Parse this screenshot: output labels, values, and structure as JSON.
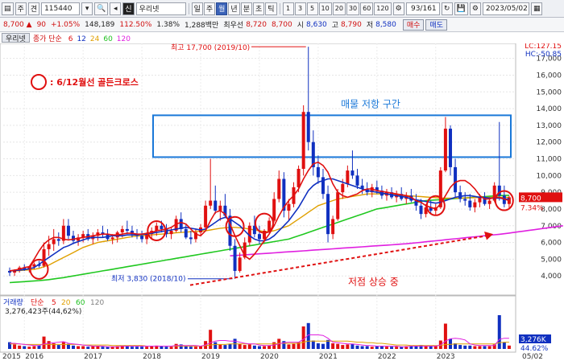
{
  "toolbar": {
    "market": "주",
    "code_type": "견",
    "code": "115440",
    "name_flag": "신",
    "name": "우리넷",
    "periods": [
      "일",
      "주",
      "월",
      "년",
      "분",
      "초",
      "틱"
    ],
    "active_period": "월",
    "intervals": [
      "1",
      "3",
      "5",
      "10",
      "20",
      "30",
      "60",
      "120"
    ],
    "page": "93/161",
    "date": "2023/05/02"
  },
  "quote": {
    "price": "8,700",
    "change": "90",
    "change_pct": "+1.05%",
    "volume": "148,189",
    "vol_ratio": "112.50%",
    "turnover_rate": "1.38%",
    "amount": "1,288백만",
    "best_label": "최우선",
    "best_value": "8,720",
    "current": "8,700",
    "open_label": "시",
    "open": "8,630",
    "high_label": "고",
    "high": "8,790",
    "low_label": "저",
    "low": "8,580",
    "buy_label": "매수",
    "sell_label": "매도"
  },
  "main_tab": "우리넷",
  "main_legend": {
    "title": "종가 단순",
    "ma": [
      {
        "label": "6",
        "color": "#e01010"
      },
      {
        "label": "12",
        "color": "#1030c0"
      },
      {
        "label": "24",
        "color": "#e0a000"
      },
      {
        "label": "60",
        "color": "#20c020"
      },
      {
        "label": "120",
        "color": "#e020e0"
      }
    ]
  },
  "volume_tab": "거래량",
  "volume_legend": {
    "title": "단순",
    "ma": [
      {
        "label": "5",
        "color": "#e01010"
      },
      {
        "label": "20",
        "color": "#e0a000"
      },
      {
        "label": "60",
        "color": "#20c020"
      },
      {
        "label": "120",
        "color": "#808080"
      }
    ]
  },
  "volume_value": "3,276,423주(44,62%)",
  "annotations": {
    "golden_cross": ": 6/12월선 골든크로스",
    "resistance": "매물 저항 구간",
    "rising_low": "저점 상승 중",
    "high_label": "최고 17,700 (2019/10)",
    "low_label": "최저 3,830 (2018/10)"
  },
  "axis_info": {
    "lc": "LC:127.15",
    "hc": "HC:-50.85",
    "current_price": "8,700",
    "pct": "7.34%",
    "vol_current": "3,276K",
    "vol_pct": "44.62%",
    "last_date": "05/02"
  },
  "chart_data": {
    "type": "candlestick",
    "ylim": [
      3000,
      17800
    ],
    "y_ticks": [
      "17,000",
      "16,000",
      "15,000",
      "14,000",
      "13,000",
      "12,000",
      "11,000",
      "10,000",
      "9,000",
      "8,000",
      "7,000",
      "6,000",
      "5,000",
      "4,000"
    ],
    "x_ticks": [
      "2015",
      "2016",
      "2017",
      "2018",
      "2019",
      "2020",
      "2021",
      "2022",
      "2023"
    ],
    "colors": {
      "up": "#e01010",
      "down": "#1030c0"
    },
    "start": "2015-10",
    "candles": [
      [
        4300,
        4500,
        4000,
        4200
      ],
      [
        4200,
        4400,
        4000,
        4350
      ],
      [
        4350,
        4600,
        4200,
        4500
      ],
      [
        4500,
        4700,
        4300,
        4400
      ],
      [
        4400,
        4600,
        4200,
        4550
      ],
      [
        4550,
        4800,
        4400,
        4700
      ],
      [
        4700,
        4900,
        4500,
        4600
      ],
      [
        4600,
        6000,
        4500,
        5600
      ],
      [
        5600,
        6400,
        5200,
        5900
      ],
      [
        5900,
        6800,
        5500,
        6200
      ],
      [
        6200,
        6600,
        5800,
        6100
      ],
      [
        6100,
        7400,
        5900,
        7000
      ],
      [
        7000,
        7400,
        6200,
        6400
      ],
      [
        6400,
        6700,
        5900,
        6100
      ],
      [
        6100,
        6500,
        5800,
        6300
      ],
      [
        6300,
        6700,
        6000,
        6500
      ],
      [
        6500,
        6800,
        6100,
        6200
      ],
      [
        6200,
        6600,
        5900,
        6400
      ],
      [
        6400,
        6800,
        6100,
        6600
      ],
      [
        6600,
        7000,
        6300,
        6500
      ],
      [
        6500,
        6800,
        6100,
        6200
      ],
      [
        6200,
        6500,
        5900,
        6300
      ],
      [
        6300,
        6700,
        6000,
        6600
      ],
      [
        6600,
        7000,
        6300,
        6800
      ],
      [
        6800,
        7300,
        6500,
        6700
      ],
      [
        6700,
        7000,
        6300,
        6500
      ],
      [
        6500,
        6800,
        6200,
        6400
      ],
      [
        6400,
        6700,
        6000,
        6200
      ],
      [
        6200,
        6600,
        5900,
        6500
      ],
      [
        6500,
        6900,
        6200,
        6700
      ],
      [
        6700,
        7200,
        6400,
        7000
      ],
      [
        7000,
        7300,
        6600,
        6800
      ],
      [
        6800,
        7100,
        6300,
        6500
      ],
      [
        6500,
        6900,
        6200,
        6700
      ],
      [
        6700,
        7600,
        6600,
        7400
      ],
      [
        7400,
        7800,
        6600,
        6800
      ],
      [
        6800,
        7100,
        6200,
        6300
      ],
      [
        6300,
        6700,
        5900,
        6200
      ],
      [
        6200,
        6800,
        6000,
        6600
      ],
      [
        6600,
        7100,
        6400,
        6900
      ],
      [
        6900,
        8500,
        6800,
        8200
      ],
      [
        8200,
        11000,
        8000,
        8500
      ],
      [
        8500,
        9400,
        7700,
        7900
      ],
      [
        7900,
        8500,
        7300,
        8200
      ],
      [
        8200,
        8900,
        7500,
        7600
      ],
      [
        7600,
        8000,
        5500,
        5800
      ],
      [
        5800,
        6200,
        3830,
        4300
      ],
      [
        4300,
        5400,
        4200,
        5100
      ],
      [
        5100,
        6300,
        5000,
        6000
      ],
      [
        6000,
        7200,
        5800,
        7000
      ],
      [
        7000,
        7600,
        6300,
        6500
      ],
      [
        6500,
        7000,
        5900,
        6200
      ],
      [
        6200,
        6800,
        6000,
        6700
      ],
      [
        6700,
        7500,
        6500,
        7300
      ],
      [
        7300,
        9000,
        7200,
        8600
      ],
      [
        8600,
        10300,
        8400,
        9800
      ],
      [
        9800,
        10200,
        7500,
        7900
      ],
      [
        7900,
        8600,
        7300,
        8300
      ],
      [
        8300,
        9600,
        8100,
        9300
      ],
      [
        9300,
        10600,
        9000,
        10400
      ],
      [
        10400,
        14200,
        10000,
        13800
      ],
      [
        13800,
        17700,
        11500,
        12000
      ],
      [
        12000,
        12700,
        10000,
        10500
      ],
      [
        10500,
        11200,
        9500,
        9900
      ],
      [
        9900,
        10400,
        8600,
        8900
      ],
      [
        8900,
        9400,
        6000,
        6500
      ],
      [
        6500,
        7600,
        6200,
        7400
      ],
      [
        7400,
        9200,
        7300,
        9000
      ],
      [
        9000,
        9800,
        8600,
        9500
      ],
      [
        9500,
        10600,
        9300,
        10300
      ],
      [
        10300,
        11500,
        9800,
        10000
      ],
      [
        10000,
        10400,
        9200,
        9400
      ],
      [
        9400,
        9800,
        8900,
        9200
      ],
      [
        9200,
        9600,
        8800,
        9000
      ],
      [
        9000,
        9500,
        8700,
        9300
      ],
      [
        9300,
        9700,
        8900,
        9100
      ],
      [
        9100,
        9400,
        8600,
        8800
      ],
      [
        8800,
        9200,
        8500,
        9000
      ],
      [
        9000,
        9300,
        8600,
        8700
      ],
      [
        8700,
        9100,
        8400,
        8900
      ],
      [
        8900,
        9300,
        8500,
        8600
      ],
      [
        8600,
        9000,
        8300,
        8800
      ],
      [
        8800,
        9200,
        8400,
        8500
      ],
      [
        8500,
        8900,
        7900,
        8200
      ],
      [
        8200,
        8600,
        7400,
        7700
      ],
      [
        7700,
        8300,
        7500,
        8100
      ],
      [
        8100,
        8500,
        7700,
        7900
      ],
      [
        7900,
        8300,
        7600,
        8100
      ],
      [
        8100,
        10500,
        8000,
        10300
      ],
      [
        10300,
        13500,
        10200,
        12800
      ],
      [
        12800,
        13000,
        10000,
        10500
      ],
      [
        10500,
        11000,
        8700,
        9000
      ],
      [
        9000,
        9400,
        8400,
        8600
      ],
      [
        8600,
        9000,
        8200,
        8500
      ],
      [
        8500,
        8900,
        7900,
        8100
      ],
      [
        8100,
        8600,
        7800,
        8400
      ],
      [
        8400,
        8900,
        8100,
        8700
      ],
      [
        8700,
        9000,
        8200,
        8300
      ],
      [
        8300,
        8700,
        8000,
        8500
      ],
      [
        8500,
        9600,
        8400,
        9400
      ],
      [
        9400,
        13200,
        8500,
        8800
      ],
      [
        8800,
        9400,
        8100,
        8300
      ],
      [
        8300,
        8800,
        8000,
        8700
      ]
    ],
    "ma6": [
      4300,
      4350,
      4400,
      4500,
      4550,
      5000,
      5500,
      5900,
      6150,
      6300,
      6300,
      6200,
      6150,
      6200,
      6250,
      6300,
      6350,
      6400,
      6450,
      6500,
      6500,
      6450,
      6450,
      6500,
      6550,
      6550,
      6500,
      6500,
      6550,
      6600,
      6700,
      6750,
      6800,
      6900,
      7100,
      7200,
      7100,
      6800,
      6500,
      6400,
      6700,
      7300,
      7800,
      7900,
      7700,
      7100,
      6400,
      5800,
      5200,
      5000,
      5300,
      5700,
      6100,
      6500,
      7000,
      7600,
      8100,
      8500,
      8800,
      9200,
      9800,
      10300,
      10700,
      10800,
      10600,
      10200,
      9500,
      9000,
      8800,
      8700,
      8800,
      8900,
      9100,
      9200,
      9200,
      9100,
      9050,
      9000,
      8950,
      8900,
      8850,
      8800,
      8700,
      8500,
      8400,
      8200,
      8100,
      8000,
      8300,
      8800,
      9300,
      9600,
      9700,
      9700,
      9500,
      9200,
      8800,
      8600,
      8600,
      8700,
      8700,
      8600,
      8500
    ],
    "ma12": [
      4300,
      4320,
      4350,
      4380,
      4420,
      4500,
      4700,
      4900,
      5100,
      5300,
      5500,
      5700,
      5800,
      5950,
      6050,
      6150,
      6250,
      6300,
      6300,
      6300,
      6350,
      6400,
      6400,
      6400,
      6450,
      6450,
      6450,
      6480,
      6500,
      6550,
      6600,
      6650,
      6700,
      6750,
      6800,
      6850,
      6900,
      6850,
      6800,
      6750,
      6800,
      7000,
      7200,
      7400,
      7500,
      7400,
      7200,
      7000,
      6700,
      6400,
      6200,
      6100,
      6100,
      6200,
      6400,
      6700,
      7000,
      7300,
      7700,
      8100,
      8600,
      9100,
      9400,
      9600,
      9700,
      9800,
      9800,
      9700,
      9600,
      9500,
      9400,
      9300,
      9200,
      9100,
      9050,
      9000,
      8950,
      8900,
      8850,
      8800,
      8750,
      8700,
      8600,
      8550,
      8500,
      8450,
      8400,
      8350,
      8400,
      8500,
      8600,
      8700,
      8750,
      8800,
      8800,
      8750,
      8700,
      8700,
      8650,
      8650,
      8650,
      8600,
      8600
    ],
    "ma24": [
      4300,
      4300,
      4320,
      4340,
      4360,
      4400,
      4450,
      4550,
      4650,
      4800,
      4950,
      5100,
      5250,
      5400,
      5550,
      5700,
      5800,
      5900,
      6000,
      6050,
      6100,
      6150,
      6200,
      6250,
      6300,
      6350,
      6380,
      6400,
      6420,
      6450,
      6480,
      6500,
      6520,
      6550,
      6580,
      6600,
      6620,
      6640,
      6660,
      6680,
      6700,
      6750,
      6800,
      6850,
      6880,
      6900,
      6900,
      6880,
      6850,
      6800,
      6750,
      6700,
      6650,
      6650,
      6700,
      6800,
      6900,
      7000,
      7200,
      7400,
      7600,
      7800,
      8000,
      8200,
      8300,
      8400,
      8500,
      8600,
      8650,
      8700,
      8750,
      8800,
      8850,
      8900,
      8900,
      8900,
      8900,
      8880,
      8860,
      8840,
      8820,
      8800,
      8780,
      8760,
      8740,
      8720,
      8700,
      8680,
      8660,
      8650,
      8650,
      8650,
      8650,
      8660,
      8670,
      8680,
      8690,
      8700,
      8700,
      8700,
      8700,
      8700,
      8700
    ],
    "ma60": [
      3600,
      3620,
      3640,
      3660,
      3680,
      3700,
      3720,
      3750,
      3780,
      3820,
      3860,
      3900,
      3950,
      4000,
      4050,
      4100,
      4150,
      4200,
      4250,
      4300,
      4350,
      4400,
      4450,
      4500,
      4550,
      4600,
      4650,
      4700,
      4750,
      4800,
      4850,
      4900,
      4950,
      5000,
      5050,
      5100,
      5150,
      5200,
      5250,
      5300,
      5350,
      5400,
      5450,
      5500,
      5550,
      5600,
      5650,
      5700,
      5750,
      5800,
      5850,
      5900,
      5950,
      6000,
      6050,
      6100,
      6150,
      6200,
      6300,
      6400,
      6500,
      6600,
      6700,
      6800,
      6900,
      7000,
      7100,
      7200,
      7300,
      7400,
      7500,
      7600,
      7700,
      7800,
      7900,
      8000,
      8050,
      8100,
      8150,
      8200,
      8250,
      8300,
      8350,
      8400,
      8450,
      8500,
      8520,
      8540,
      8560,
      8580,
      8600,
      8620,
      8640,
      8660,
      8680,
      8700,
      8720,
      8740,
      8760,
      8780,
      8800,
      8810,
      8820
    ],
    "ma120_start": 45,
    "ma120": [
      5200,
      5220,
      5240,
      5260,
      5280,
      5300,
      5320,
      5340,
      5360,
      5380,
      5400,
      5420,
      5440,
      5460,
      5480,
      5500,
      5520,
      5540,
      5560,
      5580,
      5600,
      5620,
      5640,
      5660,
      5680,
      5700,
      5720,
      5740,
      5760,
      5780,
      5800,
      5820,
      5840,
      5860,
      5880,
      5900,
      5920,
      5950,
      5980,
      6010,
      6040,
      6070,
      6100,
      6130,
      6160,
      6190,
      6220,
      6250,
      6280,
      6310,
      6340,
      6370,
      6400,
      6430,
      6460,
      6490,
      6520,
      6560,
      6600,
      6640,
      6680,
      6720,
      6760,
      6800,
      6840,
      6880,
      6920,
      6960,
      7000
    ],
    "volumes": [
      12,
      8,
      6,
      5,
      4,
      5,
      6,
      22,
      14,
      10,
      7,
      12,
      9,
      6,
      5,
      5,
      4,
      5,
      5,
      4,
      4,
      4,
      5,
      6,
      5,
      4,
      4,
      4,
      4,
      5,
      6,
      5,
      4,
      4,
      9,
      8,
      5,
      4,
      4,
      5,
      14,
      34,
      12,
      8,
      7,
      9,
      18,
      9,
      7,
      8,
      6,
      5,
      5,
      6,
      12,
      18,
      14,
      8,
      9,
      12,
      40,
      46,
      15,
      10,
      9,
      16,
      10,
      9,
      7,
      8,
      9,
      6,
      5,
      5,
      4,
      5,
      5,
      4,
      4,
      4,
      4,
      5,
      5,
      6,
      7,
      5,
      5,
      5,
      15,
      45,
      18,
      10,
      7,
      6,
      6,
      5,
      5,
      5,
      5,
      8,
      60,
      12,
      6
    ],
    "vol_ma5": [
      10,
      10,
      9,
      8,
      7,
      6,
      6,
      9,
      10,
      11,
      12,
      13,
      10,
      9,
      8,
      7,
      6,
      5,
      5,
      5,
      4,
      4,
      4,
      5,
      5,
      5,
      5,
      5,
      5,
      5,
      5,
      5,
      5,
      5,
      6,
      6,
      6,
      6,
      6,
      5,
      7,
      11,
      14,
      15,
      15,
      14,
      14,
      12,
      10,
      9,
      9,
      7,
      6,
      6,
      7,
      9,
      11,
      12,
      12,
      12,
      17,
      25,
      25,
      25,
      24,
      19,
      12,
      11,
      10,
      9,
      9,
      8,
      7,
      6,
      6,
      5,
      5,
      5,
      5,
      5,
      4,
      4,
      5,
      5,
      5,
      5,
      5,
      5,
      7,
      14,
      18,
      19,
      18,
      16,
      9,
      7,
      6,
      6,
      6,
      6,
      17,
      19,
      19
    ],
    "vol_ma20": [
      9,
      9,
      9,
      8,
      8,
      8,
      8,
      8,
      8,
      8,
      8,
      8,
      8,
      8,
      8,
      7,
      7,
      7,
      7,
      7,
      7,
      6,
      6,
      6,
      6,
      6,
      6,
      6,
      5,
      5,
      5,
      5,
      5,
      5,
      5,
      5,
      5,
      5,
      5,
      5,
      6,
      7,
      8,
      8,
      8,
      9,
      9,
      9,
      9,
      9,
      9,
      9,
      9,
      9,
      9,
      10,
      10,
      10,
      10,
      10,
      12,
      14,
      14,
      14,
      14,
      14,
      14,
      14,
      14,
      14,
      13,
      12,
      12,
      11,
      11,
      10,
      10,
      9,
      8,
      7,
      7,
      7,
      6,
      6,
      6,
      6,
      6,
      6,
      6,
      8,
      8,
      9,
      9,
      9,
      9,
      9,
      9,
      9,
      9,
      9,
      11,
      12,
      12
    ]
  }
}
